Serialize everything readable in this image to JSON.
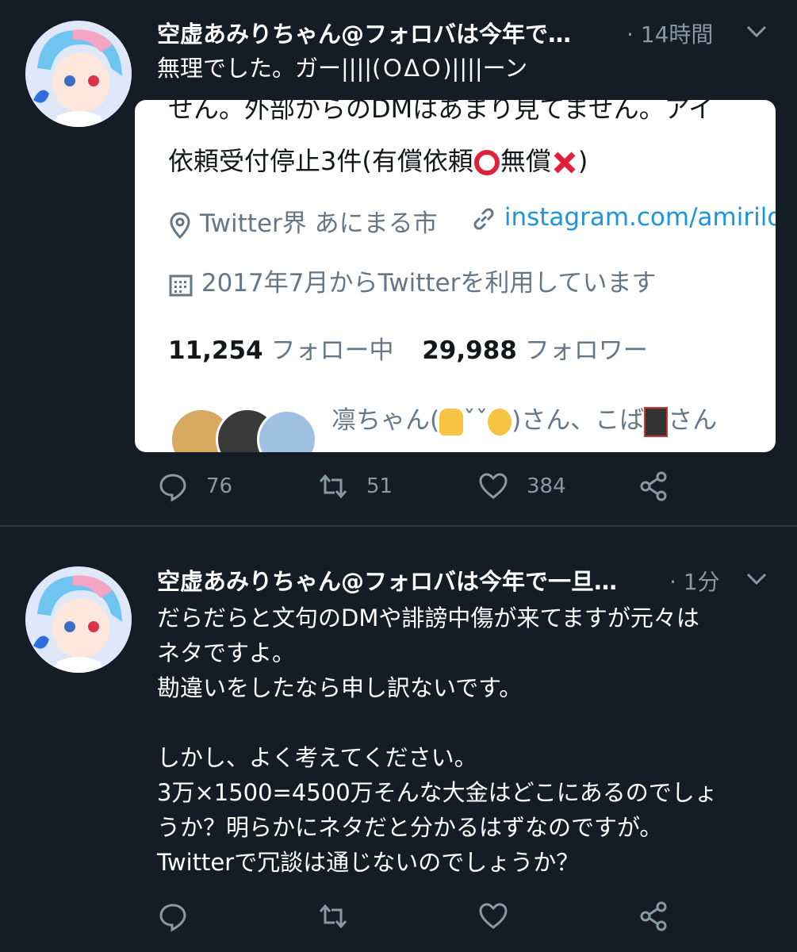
{
  "tweets": [
    {
      "display_name": "空虚あみりちゃん@フォロバは今年で…",
      "time": "· 14時間",
      "text_lines": [
        "無理でした。ガー||||(ＯΔＯ)||||ーン"
      ],
      "media": {
        "bio_line_partial": "せん。外部からのDMはあまり見てません。アイ",
        "bio_line2_before": "依頼受付停止3件(有償依頼",
        "bio_line2_mid": "無償",
        "bio_line2_after": ")",
        "location": "Twitter界 あにまる市",
        "link": "instagram.com/amirilov",
        "joined": "2017年7月からTwitterを利用しています",
        "following_count": "11,254",
        "following_label": "フォロー中",
        "followers_count": "29,988",
        "followers_label": "フォロワー",
        "followed_by_before": "凛ちゃん(",
        "followed_by_mid": "ˇˇ",
        "followed_by_after": ")さん、こば",
        "followed_by_end": "さん"
      },
      "counts": {
        "replies": "76",
        "retweets": "51",
        "likes": "384"
      }
    },
    {
      "display_name": "空虚あみりちゃん@フォロバは今年で一旦…",
      "time": "· 1分",
      "text_lines": [
        "だらだらと文句のDMや誹謗中傷が来てますが元々は",
        "ネタですよ。",
        "勘違いをしたなら申し訳ないです。",
        "",
        "しかし、よく考えてください。",
        "3万×1500=4500万そんな大金はどこにあるのでしょ",
        "うか？明らかにネタだと分かるはずなのですが。",
        "Twitterで冗談は通じないのでしょうか？"
      ]
    }
  ],
  "icons": [
    "reply-icon",
    "retweet-icon",
    "like-icon",
    "share-icon",
    "chevron-down-icon",
    "location-icon",
    "link-icon",
    "calendar-icon"
  ],
  "colors": {
    "background": "#141d26",
    "secondary_text": "#8899a6",
    "link": "#1b95e0",
    "divider": "#2b3847"
  }
}
